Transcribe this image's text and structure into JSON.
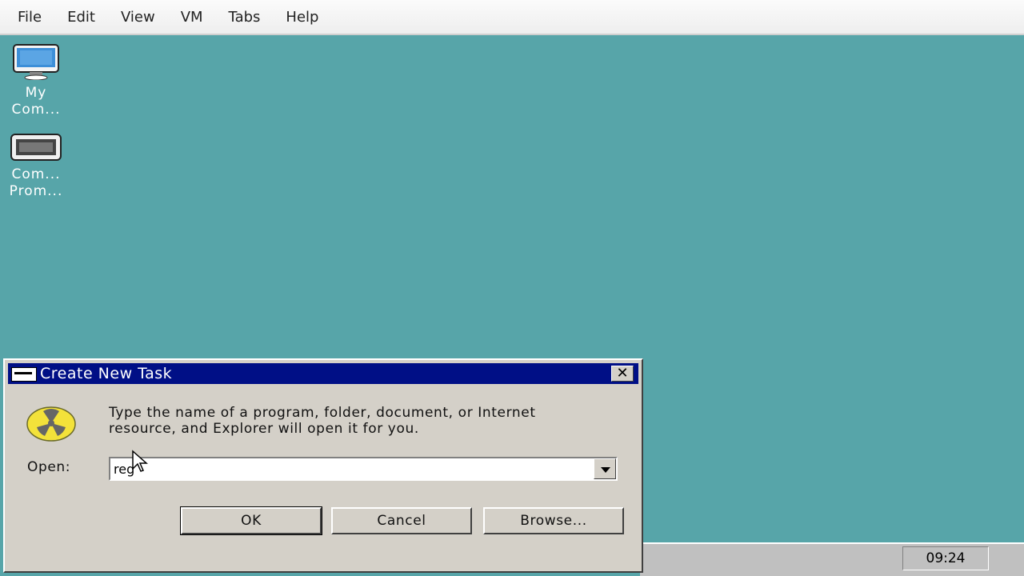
{
  "menubar": {
    "items": [
      "File",
      "Edit",
      "View",
      "VM",
      "Tabs",
      "Help"
    ]
  },
  "desktop": {
    "icons": [
      {
        "name": "my-computer",
        "line1": "My",
        "line2": "Com..."
      },
      {
        "name": "command-prompt",
        "line1": "Com...",
        "line2": "Prom..."
      }
    ]
  },
  "dialog": {
    "title": "Create New Task",
    "message_line1": "Type the name of a program, folder, document, or Internet",
    "message_line2": "resource, and Explorer will open it for you.",
    "open_label": "Open:",
    "open_value": "reg",
    "ok_label": "OK",
    "cancel_label": "Cancel",
    "browse_label": "Browse...",
    "close_label": "✕"
  },
  "taskbar": {
    "clock": "09:24"
  },
  "colors": {
    "desktop": "#57a5a9",
    "titlebar": "#000f86",
    "dialog": "#d4d0c8"
  }
}
